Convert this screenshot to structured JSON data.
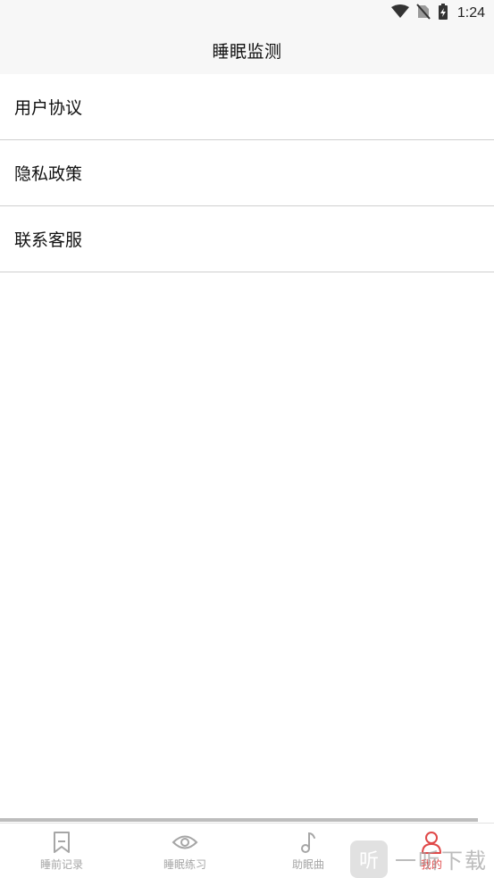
{
  "status_bar": {
    "time": "1:24",
    "icons": [
      "wifi-icon",
      "no-sim-icon",
      "battery-charging-icon"
    ]
  },
  "app_bar": {
    "title": "睡眠监测"
  },
  "menu": {
    "items": [
      {
        "label": "用户协议"
      },
      {
        "label": "隐私政策"
      },
      {
        "label": "联系客服"
      }
    ]
  },
  "tabs": [
    {
      "label": "睡前记录",
      "icon": "bookmark-icon",
      "active": false
    },
    {
      "label": "睡眠练习",
      "icon": "eye-icon",
      "active": false
    },
    {
      "label": "助眠曲",
      "icon": "music-note-icon",
      "active": false
    },
    {
      "label": "我的",
      "icon": "person-icon",
      "active": true
    }
  ],
  "watermark": {
    "badge": "听",
    "text": "一听下载"
  },
  "colors": {
    "active_tab": "#e04848",
    "inactive_tab": "#a6a6a6",
    "bar_background": "#f7f7f7",
    "divider": "#cfcfcf"
  }
}
